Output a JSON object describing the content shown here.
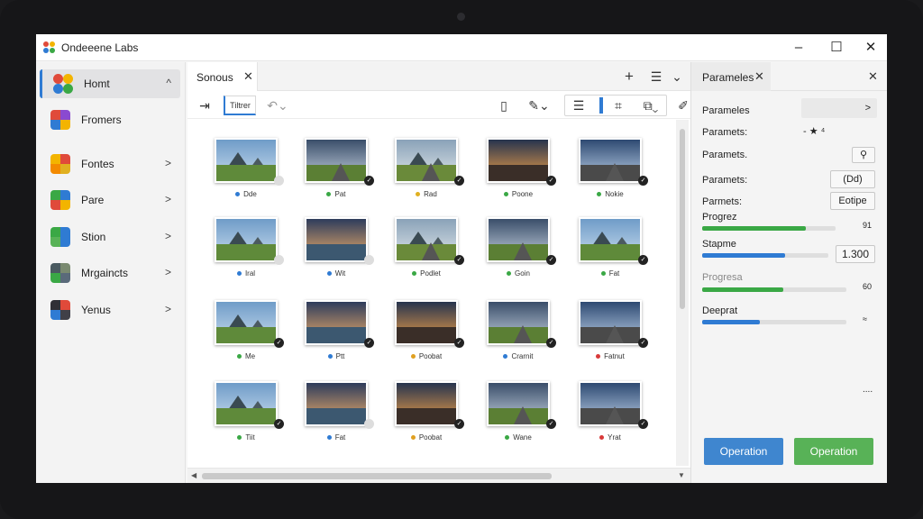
{
  "app": {
    "title": "Ondeeene Labs",
    "icon": "app-logo-icon",
    "controls": [
      "–",
      "☐",
      "✕"
    ]
  },
  "sidebar": {
    "items": [
      {
        "label": "Homt",
        "icon": "home-icon",
        "chevron": "^",
        "active": true
      },
      {
        "label": "Fromers",
        "icon": "frames-icon",
        "chevron": ""
      },
      {
        "label": "Fontes",
        "icon": "fonts-icon",
        "chevron": ">"
      },
      {
        "label": "Pare",
        "icon": "palette-icon",
        "chevron": ">"
      },
      {
        "label": "Stion",
        "icon": "station-icon",
        "chevron": ">"
      },
      {
        "label": "Mrgaincts",
        "icon": "images-icon",
        "chevron": ">"
      },
      {
        "label": "Yenus",
        "icon": "venus-icon",
        "chevron": ">"
      }
    ]
  },
  "center": {
    "tab": {
      "label": "Sonous",
      "close": "✕"
    },
    "tab_actions": {
      "add": "+",
      "list": "☰",
      "menu": "⌄"
    },
    "toolbar": {
      "filter_label": "Tiltrer",
      "icons": [
        "export-icon",
        "undo-icon",
        "panel-icon",
        "pen-icon",
        "align-icon",
        "crop-icon",
        "layers-icon",
        "edit-icon",
        "grid-icon"
      ]
    },
    "thumbnails": [
      {
        "caption": "Dde",
        "dot": "#2f7bd3",
        "scene": "mountain"
      },
      {
        "caption": "Pat",
        "dot": "#3aa845",
        "scene": "road"
      },
      {
        "caption": "Rad",
        "dot": "#e0b020",
        "scene": "valley"
      },
      {
        "caption": "Poone",
        "dot": "#3aa845",
        "scene": "sunset"
      },
      {
        "caption": "Nokie",
        "dot": "#3aa845",
        "scene": "highway"
      },
      {
        "caption": "Iral",
        "dot": "#2f7bd3",
        "scene": "mountain"
      },
      {
        "caption": "Wit",
        "dot": "#2f7bd3",
        "scene": "lake"
      },
      {
        "caption": "Podlet",
        "dot": "#3aa845",
        "scene": "valley"
      },
      {
        "caption": "Goin",
        "dot": "#3aa845",
        "scene": "road"
      },
      {
        "caption": "Fat",
        "dot": "#3aa845",
        "scene": "mountain"
      },
      {
        "caption": "Me",
        "dot": "#3aa845",
        "scene": "mountain"
      },
      {
        "caption": "Ptt",
        "dot": "#2f7bd3",
        "scene": "lake"
      },
      {
        "caption": "Poobat",
        "dot": "#e0a020",
        "scene": "sunset"
      },
      {
        "caption": "Crarnit",
        "dot": "#2f7bd3",
        "scene": "road"
      },
      {
        "caption": "Fatnut",
        "dot": "#d83a3a",
        "scene": "highway"
      },
      {
        "caption": "Tiit",
        "dot": "#3aa845",
        "scene": "mountain"
      },
      {
        "caption": "Fat",
        "dot": "#2f7bd3",
        "scene": "lake"
      },
      {
        "caption": "Poobat",
        "dot": "#e0a020",
        "scene": "sunset"
      },
      {
        "caption": "Wane",
        "dot": "#3aa845",
        "scene": "road"
      },
      {
        "caption": "Yrat",
        "dot": "#d83a3a",
        "scene": "highway"
      }
    ]
  },
  "right_panel": {
    "tab": {
      "label": "Parameles",
      "close": "✕"
    },
    "close": "✕",
    "rows": [
      {
        "label": "Parameles",
        "control": ">"
      },
      {
        "label": "Paramets:",
        "control": "- ★ ⁴"
      },
      {
        "label": "Paramets.",
        "control": "⚲"
      },
      {
        "label": "Paramets:",
        "control": "(Dd)"
      },
      {
        "label": "Parmets:",
        "control": "Eotipe"
      }
    ],
    "sliders": [
      {
        "label": "Progrez",
        "value": 0.78,
        "color": "#3aa845",
        "readout": "91"
      },
      {
        "label": "Stapme",
        "value": 0.66,
        "color": "#2f7bd3",
        "readout": "1.300"
      },
      {
        "label": "Progresa",
        "value": 0.56,
        "color": "#3aa845",
        "readout": "60"
      },
      {
        "label": "Deeprat",
        "value": 0.4,
        "color": "#2f7bd3",
        "readout": "≈"
      }
    ],
    "more": "....",
    "buttons": [
      {
        "label": "Operation",
        "color": "#3f86cf"
      },
      {
        "label": "Operation",
        "color": "#58b257"
      }
    ]
  }
}
